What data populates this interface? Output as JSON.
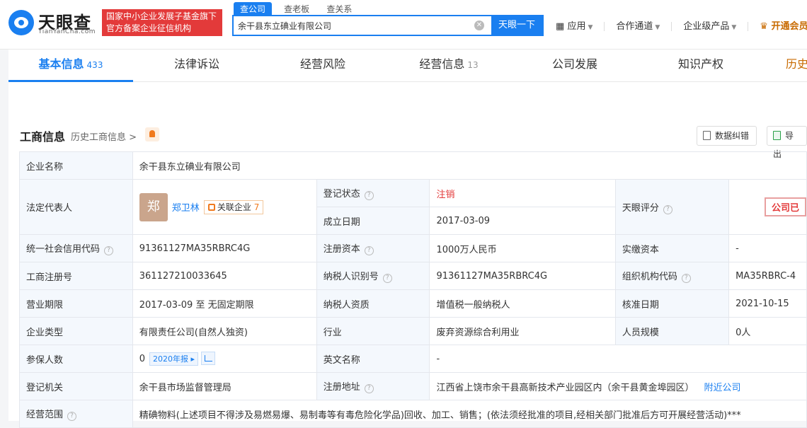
{
  "header": {
    "logo_text": "天眼查",
    "logo_sub": "TianYanCha.com",
    "gov_badge_line1": "国家中小企业发展子基金旗下",
    "gov_badge_line2": "官方备案企业征信机构",
    "search_tabs": [
      "查公司",
      "查老板",
      "查关系"
    ],
    "search_value": "余干县东立碘业有限公司",
    "search_button": "天眼一下",
    "nav": {
      "apps": "应用",
      "partners": "合作通道",
      "enterprise": "企业级产品",
      "vip": "开通会员"
    }
  },
  "tabs": [
    {
      "label": "基本信息",
      "count": "433"
    },
    {
      "label": "法律诉讼",
      "count": ""
    },
    {
      "label": "经营风险",
      "count": ""
    },
    {
      "label": "经营信息",
      "count": "13"
    },
    {
      "label": "公司发展",
      "count": ""
    },
    {
      "label": "知识产权",
      "count": ""
    },
    {
      "label": "历史",
      "count": ""
    }
  ],
  "section": {
    "title": "工商信息",
    "history_link": "历史工商信息 >",
    "btn_correct": "数据纠错",
    "btn_export": "导出"
  },
  "info": {
    "company_name_label": "企业名称",
    "company_name": "余干县东立碘业有限公司",
    "legal_rep_label": "法定代表人",
    "legal_rep_avatar": "郑",
    "legal_rep_name": "郑卫林",
    "related_label": "关联企业",
    "related_count": "7",
    "reg_status_label": "登记状态",
    "reg_status": "注销",
    "founded_label": "成立日期",
    "founded": "2017-03-09",
    "score_label": "天眼评分",
    "score_stamp": "公司已",
    "credit_code_label": "统一社会信用代码",
    "credit_code": "91361127MA35RBRC4G",
    "reg_capital_label": "注册资本",
    "reg_capital": "1000万人民币",
    "paid_capital_label": "实缴资本",
    "paid_capital": "-",
    "reg_no_label": "工商注册号",
    "reg_no": "361127210033645",
    "taxpayer_id_label": "纳税人识别号",
    "taxpayer_id": "91361127MA35RBRC4G",
    "org_code_label": "组织机构代码",
    "org_code": "MA35RBRC-4",
    "term_label": "营业期限",
    "term": "2017-03-09 至 无固定期限",
    "taxpayer_qual_label": "纳税人资质",
    "taxpayer_qual": "增值税一般纳税人",
    "approval_date_label": "核准日期",
    "approval_date": "2021-10-15",
    "type_label": "企业类型",
    "type": "有限责任公司(自然人独资)",
    "industry_label": "行业",
    "industry": "废弃资源综合利用业",
    "staff_label": "人员规模",
    "staff": "0人",
    "insured_label": "参保人数",
    "insured": "0",
    "insured_report": "2020年报",
    "english_name_label": "英文名称",
    "english_name": "-",
    "authority_label": "登记机关",
    "authority": "余干县市场监督管理局",
    "address_label": "注册地址",
    "address": "江西省上饶市余干县高新技术产业园区内（余干县黄金埠园区）",
    "nearby_link": "附近公司",
    "scope_label": "经营范围",
    "scope": "精碘物料(上述项目不得涉及易燃易爆、易制毒等有毒危险化学品)回收、加工、销售；(依法须经批准的项目,经相关部门批准后方可开展经营活动)***"
  }
}
